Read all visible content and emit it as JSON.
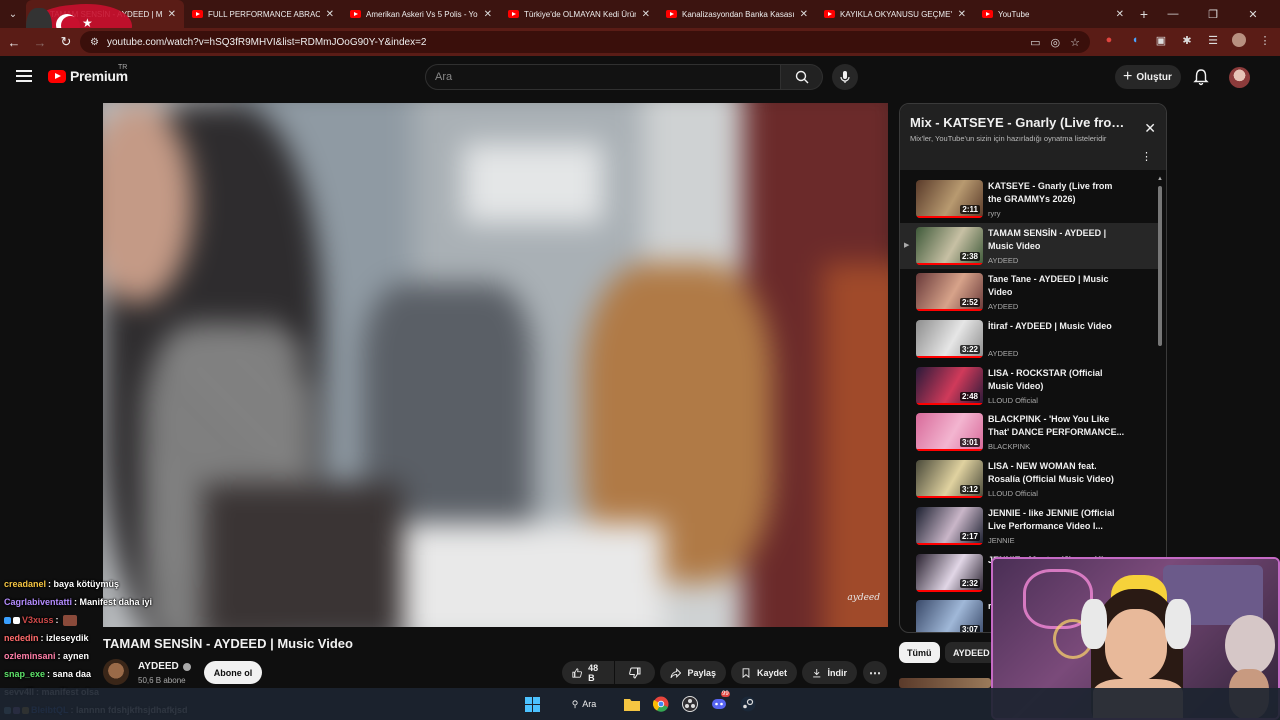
{
  "browser": {
    "tabs": [
      {
        "title": "TAMAM SENSİN - AYDEED | Mu",
        "active": true
      },
      {
        "title": "FULL PERFORMANCE ABRACAD",
        "active": false
      },
      {
        "title": "Amerikan Askeri Vs 5 Polis - Yo",
        "active": false
      },
      {
        "title": "Türkiye'de OLMAYAN Kedi Ürün",
        "active": false
      },
      {
        "title": "Kanalizasyondan Banka Kasasın",
        "active": false
      },
      {
        "title": "KAYIKLA OKYANUSU GEÇMEYE",
        "active": false
      },
      {
        "title": "YouTube",
        "active": false
      }
    ],
    "tab_close_glyph": "✕",
    "new_tab_glyph": "+",
    "url": "youtube.com/watch?v=hSQ3fR9MHVI&list=RDMmJOoG90Y-Y&index=2"
  },
  "yt_header": {
    "logo_text": "Premium",
    "region": "TR",
    "search_placeholder": "Ara",
    "create_label": "Oluştur"
  },
  "video": {
    "watermark": "aydeed",
    "title": "TAMAM SENSİN - AYDEED | Music Video",
    "channel": "AYDEED",
    "subscribers": "50,6 B abone",
    "subscribe_label": "Abone ol",
    "like_count": "48 B",
    "share_label": "Paylaş",
    "save_label": "Kaydet",
    "download_label": "İndir"
  },
  "playlist": {
    "title": "Mix - KATSEYE - Gnarly (Live from...",
    "subtitle": "Mix'ler, YouTube'un sizin için hazırladığı oynatma listeleridir",
    "items": [
      {
        "title": "KATSEYE - Gnarly (Live from the GRAMMYs 2026)",
        "channel": "ryry",
        "duration": "2:11",
        "active": false
      },
      {
        "title": "TAMAM SENSİN - AYDEED | Music Video",
        "channel": "AYDEED",
        "duration": "2:38",
        "active": true
      },
      {
        "title": "Tane Tane - AYDEED | Music Video",
        "channel": "AYDEED",
        "duration": "2:52",
        "active": false
      },
      {
        "title": "İtiraf - AYDEED | Music Video",
        "channel": "AYDEED",
        "duration": "3:22",
        "active": false
      },
      {
        "title": "LISA - ROCKSTAR (Official Music Video)",
        "channel": "LLOUD Official",
        "duration": "2:48",
        "active": false
      },
      {
        "title": "BLACKPINK - 'How You Like That' DANCE PERFORMANCE...",
        "channel": "BLACKPINK",
        "duration": "3:01",
        "active": false
      },
      {
        "title": "LISA - NEW WOMAN feat. Rosalía (Official Music Video)",
        "channel": "LLOUD Official",
        "duration": "3:12",
        "active": false
      },
      {
        "title": "JENNIE - like JENNIE (Official Live Performance Video I...",
        "channel": "JENNIE",
        "duration": "2:17",
        "active": false
      },
      {
        "title": "JENNIE - Mantra (Jimmy Ki...",
        "channel": "",
        "duration": "2:32",
        "active": false
      },
      {
        "title": "r...",
        "channel": "",
        "duration": "3:07",
        "active": false
      }
    ]
  },
  "chips": [
    {
      "label": "Tümü",
      "selected": true
    },
    {
      "label": "AYDEED a",
      "selected": false
    }
  ],
  "chat": [
    {
      "user": "creadanel",
      "color": "#f5c542",
      "msg": ": baya kötüymüş",
      "badges": []
    },
    {
      "user": "Cagrlabiventatti",
      "color": "#b48cff",
      "msg": ": Manifest daha iyi",
      "badges": []
    },
    {
      "user": "V3xuss",
      "color": "#d04a4a",
      "msg": ":",
      "badges": [
        "#3aa0ff",
        "#ffffff"
      ]
    },
    {
      "user": "nededin",
      "color": "#ff6b6b",
      "msg": ": izleseydik",
      "badges": []
    },
    {
      "user": "ozleminsani",
      "color": "#ff7fa8",
      "msg": ": aynen",
      "badges": []
    },
    {
      "user": "snap_exe",
      "color": "#5ee36a",
      "msg": ": sana daa",
      "badges": []
    },
    {
      "user": "sevv4ll",
      "color": "#ffffff",
      "msg": ": manifest olsa",
      "badges": []
    },
    {
      "user": "BleibtQL",
      "color": "#3a86ff",
      "msg": ": lannnn fdshjkfhsjdhafkjsd",
      "badges": [
        "#8ed1fc",
        "#b48cff",
        "#f5c542"
      ]
    }
  ],
  "taskbar": {
    "search_label": "Ara",
    "discord_badge": "99"
  },
  "colors": {
    "accent": "#ff0000",
    "browser_frame": "#5a1c16",
    "background": "#0f0f0f"
  }
}
